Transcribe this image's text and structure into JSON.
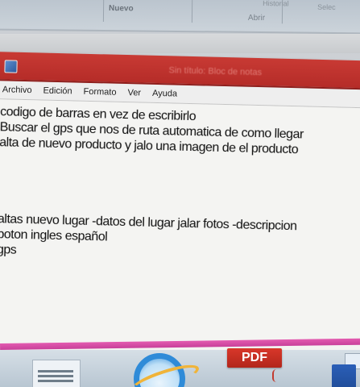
{
  "background_app": {
    "ribbon_labels": {
      "nuevo": "Nuevo",
      "abrir": "Abrir",
      "historial": "Historial",
      "seleccion": "Selec"
    }
  },
  "notepad": {
    "title": "Sin título: Bloc de notas",
    "menu": [
      "Archivo",
      "Edición",
      "Formato",
      "Ver",
      "Ayuda"
    ],
    "lines": [
      "codigo de barras en vez de escribirlo",
      "Buscar el gps que nos de ruta automatica de como llegar",
      "alta de nuevo producto y jalo una imagen de el producto",
      "",
      "",
      "",
      "",
      "altas nuevo lugar -datos del lugar jalar fotos -descripcion",
      "boton ingles español",
      "gps"
    ]
  },
  "taskbar": {
    "pdf_label": "PDF"
  },
  "colors": {
    "titlebar": "#c83a34",
    "accent_pink": "#e35bb0",
    "ie_blue": "#2f8bd8",
    "pdf_red": "#d8372a"
  },
  "icons": [
    "notepad-app-icon",
    "document-icon",
    "internet-explorer-icon",
    "pdf-icon",
    "word-icon"
  ]
}
